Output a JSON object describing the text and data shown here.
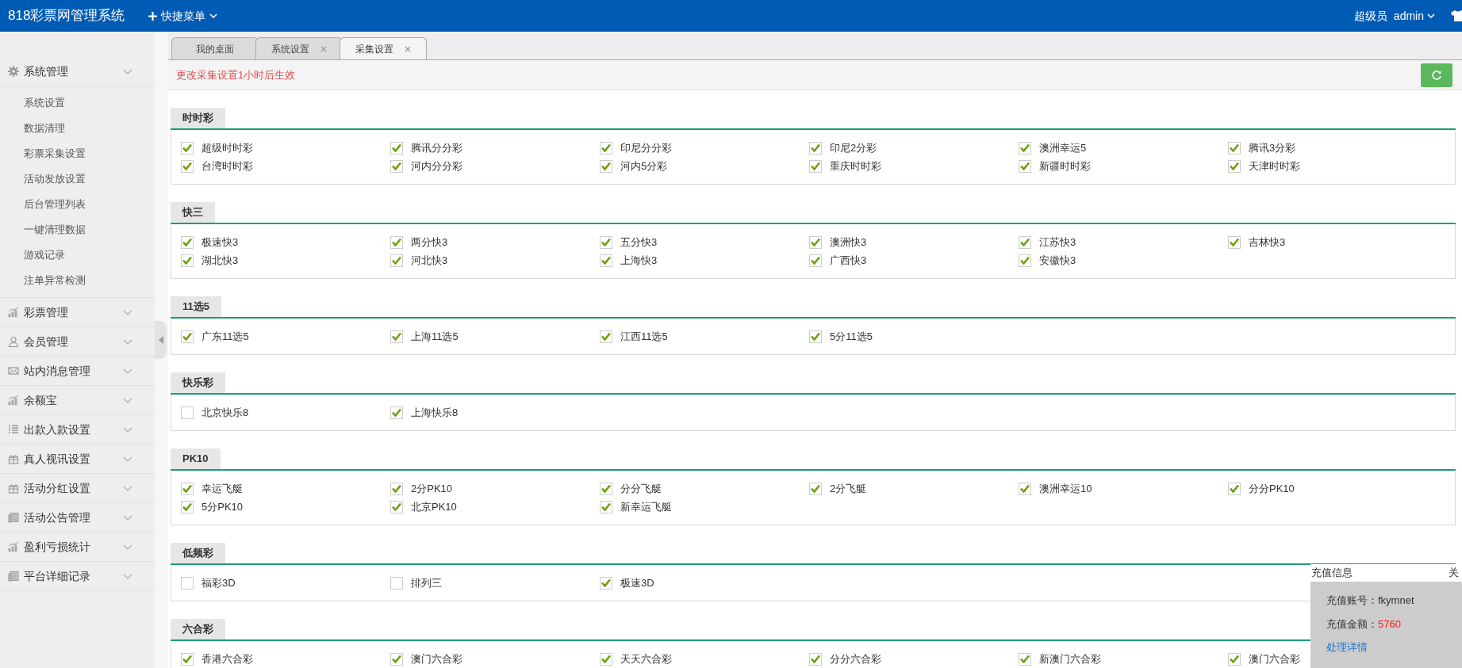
{
  "header": {
    "title": "818彩票网管理系统",
    "quick_menu": "快捷菜单",
    "role": "超级员",
    "user": "admin"
  },
  "sidebar": [
    {
      "label": "系统管理",
      "children": [
        {
          "label": "系统设置"
        },
        {
          "label": "数据清理"
        },
        {
          "label": "彩票采集设置"
        },
        {
          "label": "活动发放设置"
        },
        {
          "label": "后台管理列表"
        },
        {
          "label": "一键清理数据"
        },
        {
          "label": "游戏记录"
        },
        {
          "label": "注单异常检测"
        }
      ]
    },
    {
      "label": "彩票管理"
    },
    {
      "label": "会员管理"
    },
    {
      "label": "站内消息管理"
    },
    {
      "label": "余额宝"
    },
    {
      "label": "出款入款设置"
    },
    {
      "label": "真人视讯设置"
    },
    {
      "label": "活动分红设置"
    },
    {
      "label": "活动公告管理"
    },
    {
      "label": "盈利亏损统计"
    },
    {
      "label": "平台详细记录"
    }
  ],
  "tabs": [
    {
      "label": "我的桌面",
      "closable": false,
      "selected": false
    },
    {
      "label": "系统设置",
      "closable": true,
      "selected": false
    },
    {
      "label": "采集设置",
      "closable": true,
      "selected": true
    }
  ],
  "notice": "更改采集设置1小时后生效",
  "sections": [
    {
      "title": "时时彩",
      "items": [
        {
          "label": "超级时时彩",
          "checked": true
        },
        {
          "label": "腾讯分分彩",
          "checked": true
        },
        {
          "label": "印尼分分彩",
          "checked": true
        },
        {
          "label": "印尼2分彩",
          "checked": true
        },
        {
          "label": "澳洲幸运5",
          "checked": true
        },
        {
          "label": "腾讯3分彩",
          "checked": true
        },
        {
          "label": "台湾时时彩",
          "checked": true
        },
        {
          "label": "河内分分彩",
          "checked": true
        },
        {
          "label": "河内5分彩",
          "checked": true
        },
        {
          "label": "重庆时时彩",
          "checked": true
        },
        {
          "label": "新疆时时彩",
          "checked": true
        },
        {
          "label": "天津时时彩",
          "checked": true
        }
      ]
    },
    {
      "title": "快三",
      "items": [
        {
          "label": "极速快3",
          "checked": true
        },
        {
          "label": "两分快3",
          "checked": true
        },
        {
          "label": "五分快3",
          "checked": true
        },
        {
          "label": "澳洲快3",
          "checked": true
        },
        {
          "label": "江苏快3",
          "checked": true
        },
        {
          "label": "吉林快3",
          "checked": true
        },
        {
          "label": "湖北快3",
          "checked": true
        },
        {
          "label": "河北快3",
          "checked": true
        },
        {
          "label": "上海快3",
          "checked": true
        },
        {
          "label": "广西快3",
          "checked": true
        },
        {
          "label": "安徽快3",
          "checked": true
        }
      ]
    },
    {
      "title": "11选5",
      "items": [
        {
          "label": "广东11选5",
          "checked": true
        },
        {
          "label": "上海11选5",
          "checked": true
        },
        {
          "label": "江西11选5",
          "checked": true
        },
        {
          "label": "5分11选5",
          "checked": true
        }
      ]
    },
    {
      "title": "快乐彩",
      "items": [
        {
          "label": "北京快乐8",
          "checked": false
        },
        {
          "label": "上海快乐8",
          "checked": true
        }
      ]
    },
    {
      "title": "PK10",
      "items": [
        {
          "label": "幸运飞艇",
          "checked": true
        },
        {
          "label": "2分PK10",
          "checked": true
        },
        {
          "label": "分分飞艇",
          "checked": true
        },
        {
          "label": "2分飞艇",
          "checked": true
        },
        {
          "label": "澳洲幸运10",
          "checked": true
        },
        {
          "label": "分分PK10",
          "checked": true
        },
        {
          "label": "5分PK10",
          "checked": true
        },
        {
          "label": "北京PK10",
          "checked": true
        },
        {
          "label": "新幸运飞艇",
          "checked": true
        }
      ]
    },
    {
      "title": "低频彩",
      "items": [
        {
          "label": "福彩3D",
          "checked": false
        },
        {
          "label": "排列三",
          "checked": false
        },
        {
          "label": "极速3D",
          "checked": true
        }
      ]
    },
    {
      "title": "六合彩",
      "items": [
        {
          "label": "香港六合彩",
          "checked": true
        },
        {
          "label": "澳门六合彩",
          "checked": true
        },
        {
          "label": "天天六合彩",
          "checked": true
        },
        {
          "label": "分分六合彩",
          "checked": true
        },
        {
          "label": "新澳门六合彩",
          "checked": true
        },
        {
          "label": "澳门六合彩",
          "checked": true
        }
      ]
    }
  ],
  "popup": {
    "title": "充值信息",
    "close": "关",
    "account": "充值账号：fkymnet",
    "amount_label": "充值金额：",
    "amount": "5760",
    "link": "处理详情"
  }
}
